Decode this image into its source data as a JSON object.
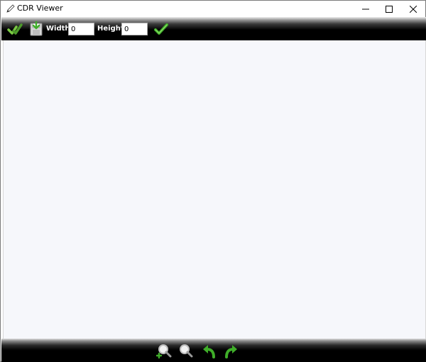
{
  "window": {
    "title": "CDR Viewer",
    "controls": {
      "minimize_icon": "minimize-icon",
      "maximize_icon": "maximize-icon",
      "close_icon": "close-icon"
    }
  },
  "toolbar": {
    "open_icon": "checkmark-tool-icon",
    "save_icon": "save-disk-icon",
    "width_label": "Width",
    "width_value": "0",
    "height_label": "Height",
    "height_value": "0",
    "apply_icon": "green-check-icon"
  },
  "bottom_toolbar": {
    "icons": [
      "zoom-in-icon",
      "zoom-out-icon",
      "rotate-left-icon",
      "rotate-right-icon"
    ]
  },
  "colors": {
    "toolbar_bg": "#000000",
    "canvas_bg": "#f6f7fb",
    "accent_green": "#3fae29"
  }
}
